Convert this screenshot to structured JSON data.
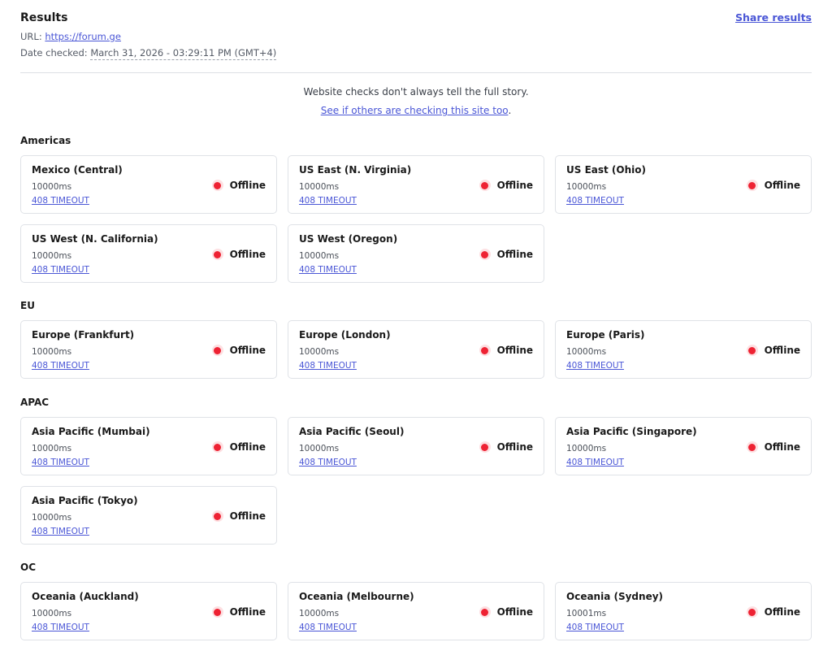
{
  "header": {
    "title": "Results",
    "share_label": "Share results",
    "url_label": "URL:",
    "url_value": "https://forum.ge",
    "date_label": "Date checked:",
    "date_value": "March 31, 2026 - 03:29:11 PM (GMT+4)"
  },
  "notice": {
    "text": "Website checks don't always tell the full story.",
    "link_text": "See if others are checking this site too",
    "link_suffix": "."
  },
  "colors": {
    "accent": "#4a56d6",
    "offline": "#ee2233",
    "offline_ring": "#fde0e2"
  },
  "status_icon": "red-dot-icon",
  "regions": [
    {
      "name": "Americas",
      "locations": [
        {
          "name": "Mexico (Central)",
          "time": "10000ms",
          "error": "408 TIMEOUT",
          "status": "Offline"
        },
        {
          "name": "US East (N. Virginia)",
          "time": "10000ms",
          "error": "408 TIMEOUT",
          "status": "Offline"
        },
        {
          "name": "US East (Ohio)",
          "time": "10000ms",
          "error": "408 TIMEOUT",
          "status": "Offline"
        },
        {
          "name": "US West (N. California)",
          "time": "10000ms",
          "error": "408 TIMEOUT",
          "status": "Offline"
        },
        {
          "name": "US West (Oregon)",
          "time": "10000ms",
          "error": "408 TIMEOUT",
          "status": "Offline"
        }
      ]
    },
    {
      "name": "EU",
      "locations": [
        {
          "name": "Europe (Frankfurt)",
          "time": "10000ms",
          "error": "408 TIMEOUT",
          "status": "Offline"
        },
        {
          "name": "Europe (London)",
          "time": "10000ms",
          "error": "408 TIMEOUT",
          "status": "Offline"
        },
        {
          "name": "Europe (Paris)",
          "time": "10000ms",
          "error": "408 TIMEOUT",
          "status": "Offline"
        }
      ]
    },
    {
      "name": "APAC",
      "locations": [
        {
          "name": "Asia Pacific (Mumbai)",
          "time": "10000ms",
          "error": "408 TIMEOUT",
          "status": "Offline"
        },
        {
          "name": "Asia Pacific (Seoul)",
          "time": "10000ms",
          "error": "408 TIMEOUT",
          "status": "Offline"
        },
        {
          "name": "Asia Pacific (Singapore)",
          "time": "10000ms",
          "error": "408 TIMEOUT",
          "status": "Offline"
        },
        {
          "name": "Asia Pacific (Tokyo)",
          "time": "10000ms",
          "error": "408 TIMEOUT",
          "status": "Offline"
        }
      ]
    },
    {
      "name": "OC",
      "locations": [
        {
          "name": "Oceania (Auckland)",
          "time": "10000ms",
          "error": "408 TIMEOUT",
          "status": "Offline"
        },
        {
          "name": "Oceania (Melbourne)",
          "time": "10000ms",
          "error": "408 TIMEOUT",
          "status": "Offline"
        },
        {
          "name": "Oceania (Sydney)",
          "time": "10001ms",
          "error": "408 TIMEOUT",
          "status": "Offline"
        }
      ]
    }
  ]
}
